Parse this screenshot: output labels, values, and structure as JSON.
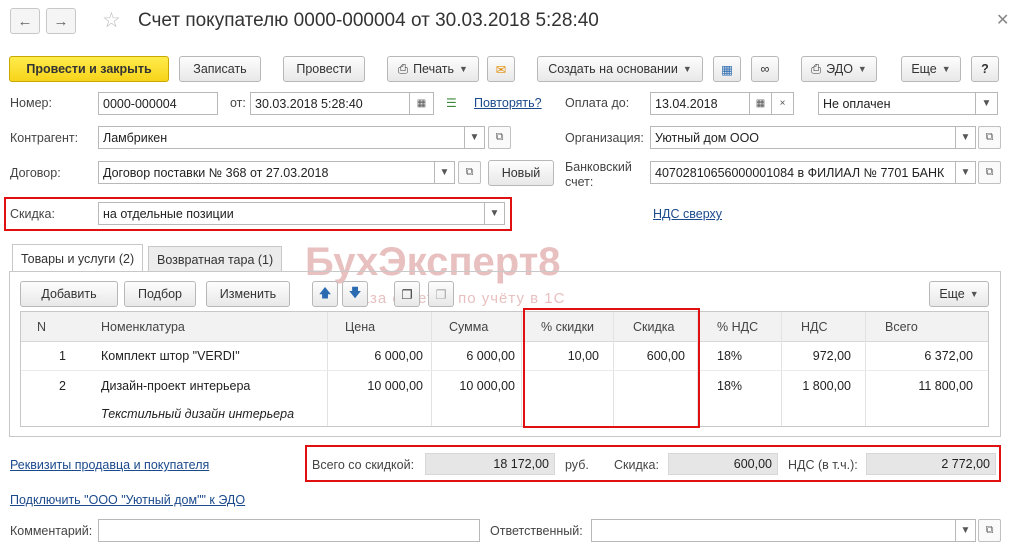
{
  "window": {
    "title": "Счет покупателю 0000-000004 от 30.03.2018 5:28:40"
  },
  "toolbar": {
    "post_close": "Провести и закрыть",
    "save": "Записать",
    "post": "Провести",
    "print": "Печать",
    "create_based": "Создать на основании",
    "edo": "ЭДО",
    "more": "Еще",
    "help": "?"
  },
  "header": {
    "number_label": "Номер:",
    "number_value": "0000-000004",
    "date_label": "от:",
    "date_value": "30.03.2018  5:28:40",
    "repeat_link": "Повторять?",
    "pay_until_label": "Оплата до:",
    "pay_until_value": "13.04.2018",
    "pay_status": "Не оплачен",
    "counterparty_label": "Контрагент:",
    "counterparty_value": "Ламбрикен",
    "org_label": "Организация:",
    "org_value": "Уютный дом ООО",
    "contract_label": "Договор:",
    "contract_value": "Договор поставки № 368 от 27.03.2018",
    "new_button": "Новый",
    "bank_label_1": "Банковский",
    "bank_label_2": "счет:",
    "bank_value": "40702810656000001084 в ФИЛИАЛ № 7701 БАНК",
    "discount_label": "Скидка:",
    "discount_value": "на отдельные позиции",
    "vat_link": "НДС сверху"
  },
  "tabs": [
    {
      "label": "Товары и услуги (2)",
      "active": true
    },
    {
      "label": "Возвратная тара (1)",
      "active": false
    }
  ],
  "watermark": {
    "brand": "БухЭксперт8",
    "tagline": "База ответов по учёту в 1С"
  },
  "table_toolbar": {
    "add": "Добавить",
    "select": "Подбор",
    "change": "Изменить",
    "more": "Еще"
  },
  "table": {
    "columns": [
      "N",
      "Номенклатура",
      "Цена",
      "Сумма",
      "% скидки",
      "Скидка",
      "% НДС",
      "НДС",
      "Всего"
    ],
    "rows": [
      {
        "n": "1",
        "name": "Комплект штор \"VERDI\"",
        "price": "6 000,00",
        "sum": "6 000,00",
        "disc_pct": "10,00",
        "disc": "600,00",
        "vat_pct": "18%",
        "vat": "972,00",
        "total": "6 372,00",
        "sub": ""
      },
      {
        "n": "2",
        "name": "Дизайн-проект интерьера",
        "price": "10 000,00",
        "sum": "10 000,00",
        "disc_pct": "",
        "disc": "",
        "vat_pct": "18%",
        "vat": "1 800,00",
        "total": "11 800,00",
        "sub": "Текстильный дизайн интерьера"
      }
    ]
  },
  "totals": {
    "total_disc_label": "Всего со скидкой:",
    "total_disc_value": "18 172,00",
    "currency": "руб.",
    "discount_label": "Скидка:",
    "discount_value": "600,00",
    "vat_label": "НДС (в т.ч.):",
    "vat_value": "2 772,00"
  },
  "footer": {
    "requisites_link": "Реквизиты продавца и покупателя",
    "edo_link": "Подключить \"ООО \"Уютный дом\"\" к ЭДО",
    "comment_label": "Комментарий:",
    "responsible_label": "Ответственный:"
  },
  "colors": {
    "primary_button": "#f7d41a",
    "highlight_border": "#e01010",
    "link": "#1b4a8c"
  }
}
